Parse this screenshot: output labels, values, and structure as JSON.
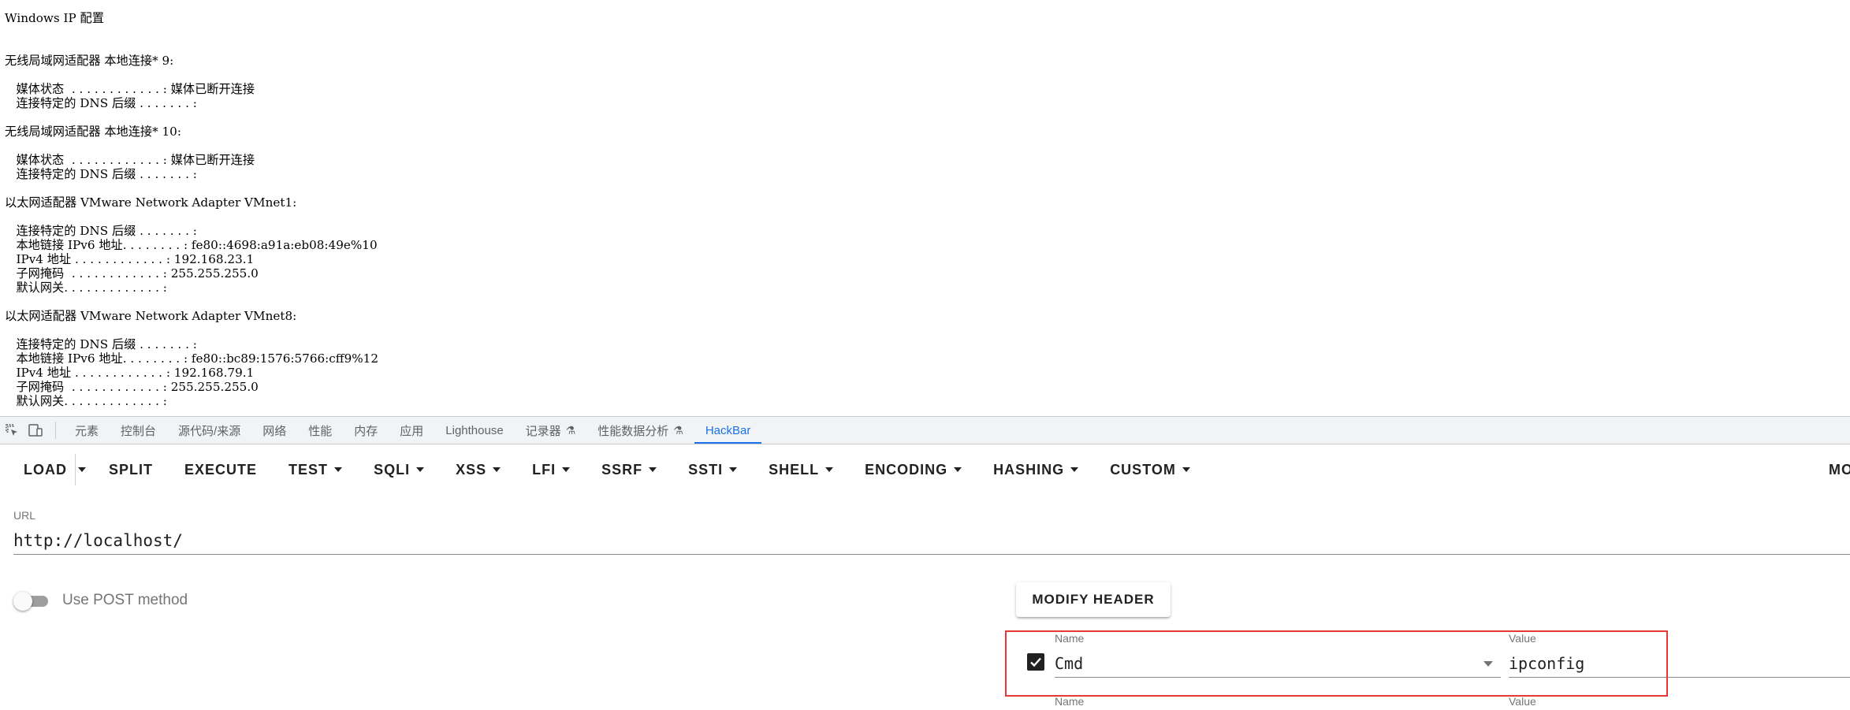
{
  "output": {
    "text": "Windows IP 配置\n\n\n无线局域网适配器 本地连接* 9:\n\n   媒体状态  . . . . . . . . . . . . : 媒体已断开连接\n   连接特定的 DNS 后缀 . . . . . . . :\n\n无线局域网适配器 本地连接* 10:\n\n   媒体状态  . . . . . . . . . . . . : 媒体已断开连接\n   连接特定的 DNS 后缀 . . . . . . . :\n\n以太网适配器 VMware Network Adapter VMnet1:\n\n   连接特定的 DNS 后缀 . . . . . . . :\n   本地链接 IPv6 地址. . . . . . . . : fe80::4698:a91a:eb08:49e%10\n   IPv4 地址 . . . . . . . . . . . . : 192.168.23.1\n   子网掩码  . . . . . . . . . . . . : 255.255.255.0\n   默认网关. . . . . . . . . . . . . :\n\n以太网适配器 VMware Network Adapter VMnet8:\n\n   连接特定的 DNS 后缀 . . . . . . . :\n   本地链接 IPv6 地址. . . . . . . . : fe80::bc89:1576:5766:cff9%12\n   IPv4 地址 . . . . . . . . . . . . : 192.168.79.1\n   子网掩码  . . . . . . . . . . . . : 255.255.255.0\n   默认网关. . . . . . . . . . . . . :"
  },
  "devtools": {
    "icons": [
      "inspect-element-icon",
      "device-toolbar-icon"
    ],
    "tabs": {
      "elements": "元素",
      "console": "控制台",
      "sources": "源代码/来源",
      "network": "网络",
      "performance": "性能",
      "memory": "内存",
      "application": "应用",
      "lighthouse": "Lighthouse",
      "recorder": "记录器",
      "performance_insights": "性能数据分析",
      "hackbar": "HackBar"
    },
    "active_tab": "HackBar",
    "accent_color": "#1a73e8"
  },
  "hackbar": {
    "toolbar": {
      "load": "LOAD",
      "split": "SPLIT",
      "execute": "EXECUTE",
      "test": "TEST",
      "sqli": "SQLI",
      "xss": "XSS",
      "lfi": "LFI",
      "ssrf": "SSRF",
      "ssti": "SSTI",
      "shell": "SHELL",
      "encoding": "ENCODING",
      "hashing": "HASHING",
      "custom": "CUSTOM",
      "more": "MO"
    },
    "url": {
      "label": "URL",
      "value": "http://localhost/"
    },
    "post": {
      "label": "Use POST method",
      "enabled": false
    },
    "modify_header_label": "MODIFY HEADER",
    "headers": [
      {
        "enabled": true,
        "name_label": "Name",
        "name": "Cmd",
        "value_label": "Value",
        "value": "ipconfig"
      },
      {
        "name_label": "Name",
        "value_label": "Value"
      }
    ],
    "highlight_color": "#e53935"
  }
}
